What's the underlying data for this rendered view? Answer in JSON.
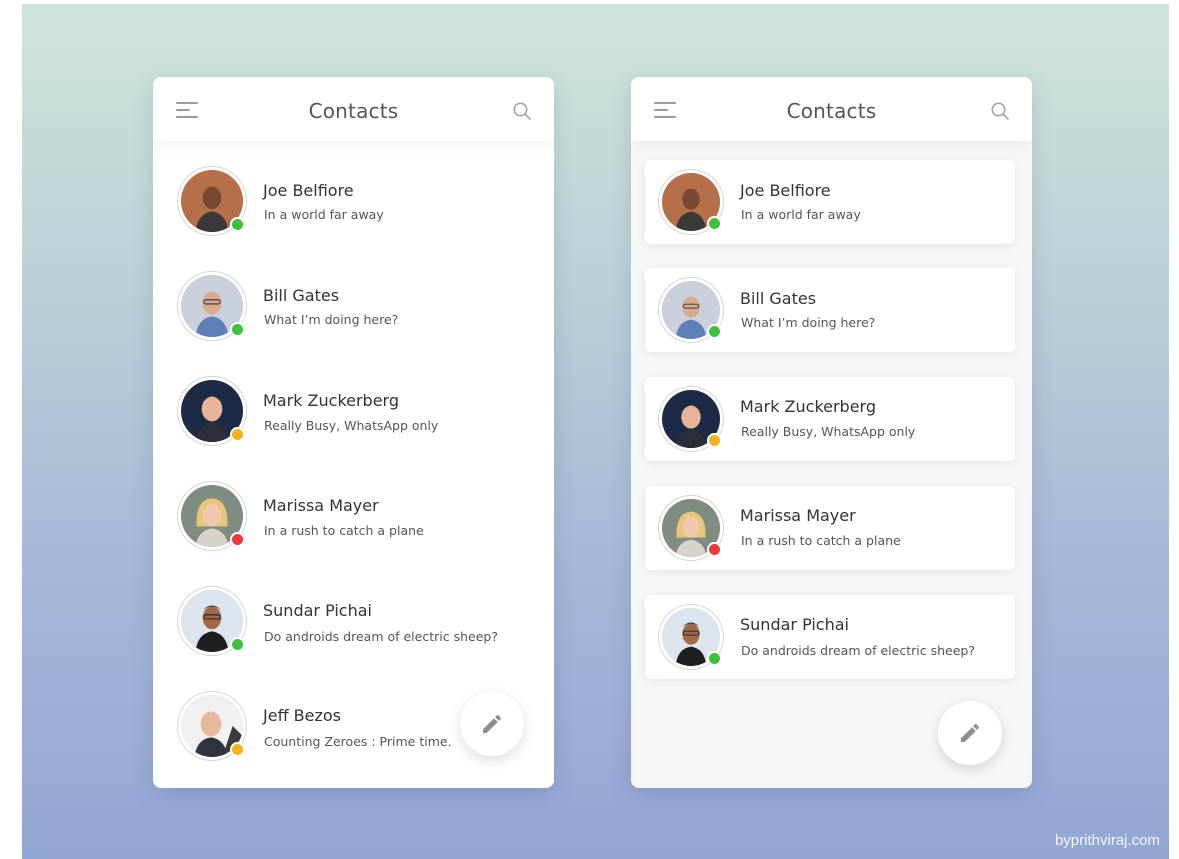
{
  "screens": [
    {
      "title": "Contacts",
      "contacts": [
        {
          "name": "Joe Belfiore",
          "status": "In a world far away",
          "presence": "online"
        },
        {
          "name": "Bill Gates",
          "status": "What I’m doing here?",
          "presence": "online"
        },
        {
          "name": "Mark Zuckerberg",
          "status": "Really Busy, WhatsApp only",
          "presence": "away"
        },
        {
          "name": "Marissa Mayer",
          "status": "In a rush to catch a plane",
          "presence": "busy"
        },
        {
          "name": "Sundar Pichai",
          "status": "Do androids dream of electric sheep?",
          "presence": "online"
        },
        {
          "name": "Jeff Bezos",
          "status": "Counting Zeroes : Prime time.",
          "presence": "away"
        }
      ],
      "fab_icon": "pencil-icon",
      "header_icons": [
        "hamburger-menu-icon",
        "search-icon"
      ]
    },
    {
      "title": "Contacts",
      "contacts": [
        {
          "name": "Joe Belfiore",
          "status": "In a world far away",
          "presence": "online"
        },
        {
          "name": "Bill Gates",
          "status": "What I’m doing here?",
          "presence": "online"
        },
        {
          "name": "Mark Zuckerberg",
          "status": "Really Busy, WhatsApp only",
          "presence": "away"
        },
        {
          "name": "Marissa Mayer",
          "status": "In a rush to catch a plane",
          "presence": "busy"
        },
        {
          "name": "Sundar Pichai",
          "status": "Do androids dream of electric sheep?",
          "presence": "online"
        }
      ],
      "fab_icon": "pencil-icon",
      "header_icons": [
        "hamburger-menu-icon",
        "search-icon"
      ]
    }
  ],
  "presence_colors": {
    "online": "#3cc13b",
    "away": "#f2b418",
    "busy": "#ea3a3a"
  },
  "watermark": "byprithviraj.com"
}
